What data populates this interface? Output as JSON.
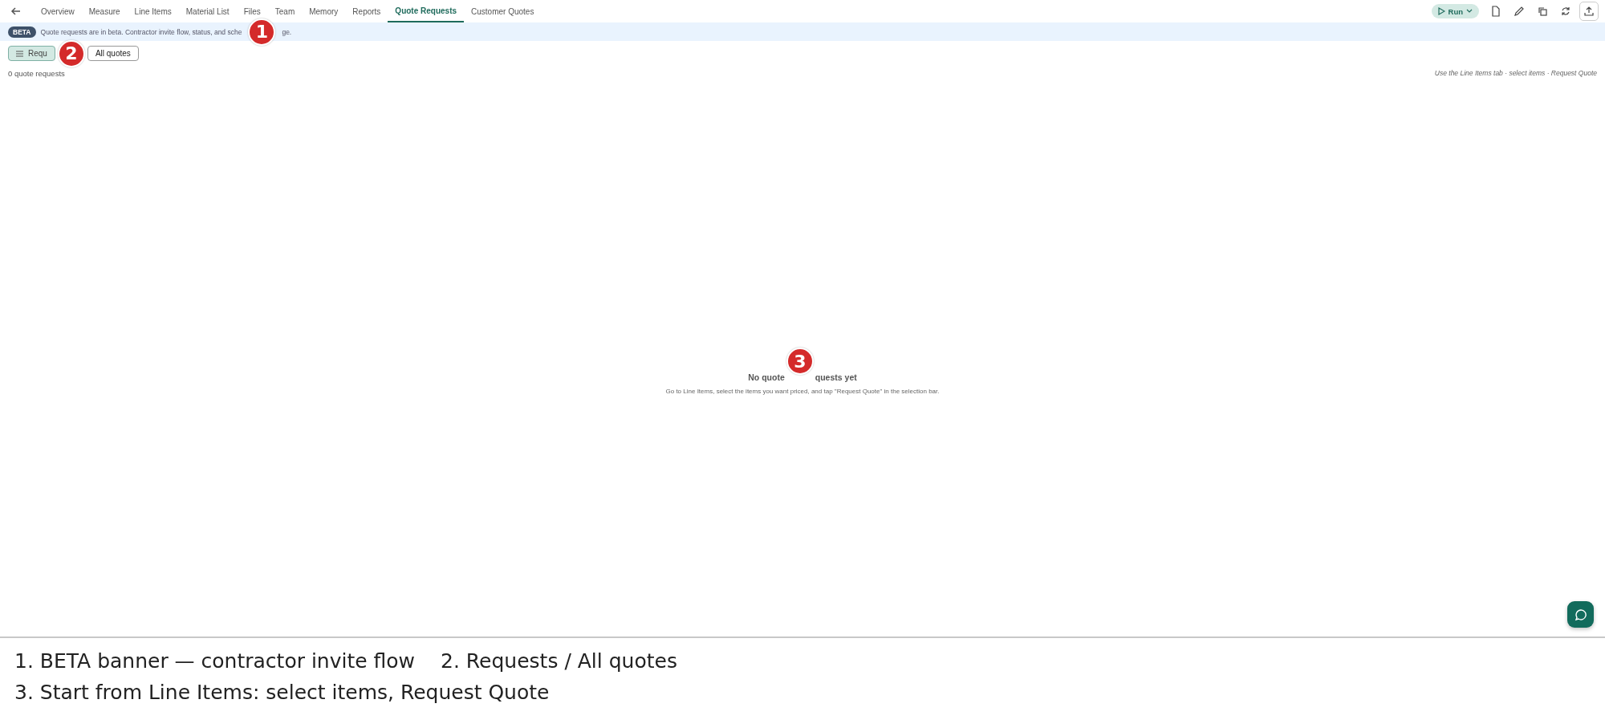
{
  "nav": {
    "tabs": [
      {
        "label": "Overview",
        "selected": false
      },
      {
        "label": "Measure",
        "selected": false
      },
      {
        "label": "Line Items",
        "selected": false
      },
      {
        "label": "Material List",
        "selected": false
      },
      {
        "label": "Files",
        "selected": false
      },
      {
        "label": "Team",
        "selected": false
      },
      {
        "label": "Memory",
        "selected": false
      },
      {
        "label": "Reports",
        "selected": false
      },
      {
        "label": "Quote Requests",
        "selected": true
      },
      {
        "label": "Customer Quotes",
        "selected": false
      }
    ],
    "run_button": "Run"
  },
  "banner": {
    "badge": "BETA",
    "text_parts": [
      "Quote requests are in beta. Contractor invite flow, status, and sche",
      "ge."
    ]
  },
  "filters": [
    {
      "label": "Requ",
      "selected": true
    },
    {
      "label": "All quotes",
      "selected": false
    }
  ],
  "count": "0 quote requests",
  "hint": "Use the Line Items tab · select items · Request Quote",
  "empty": {
    "title_parts": [
      "No quote",
      "quests yet"
    ],
    "text": "Go to Line Items, select the items you want priced, and tap \"Request Quote\" in the selection bar."
  },
  "markers": [
    "1",
    "2",
    "3"
  ],
  "caption": {
    "lines": [
      [
        "1. BETA banner — contractor invite flow",
        "2. Requests / All quotes"
      ],
      [
        "3. Start from Line Items: select items, Request Quote"
      ]
    ]
  }
}
